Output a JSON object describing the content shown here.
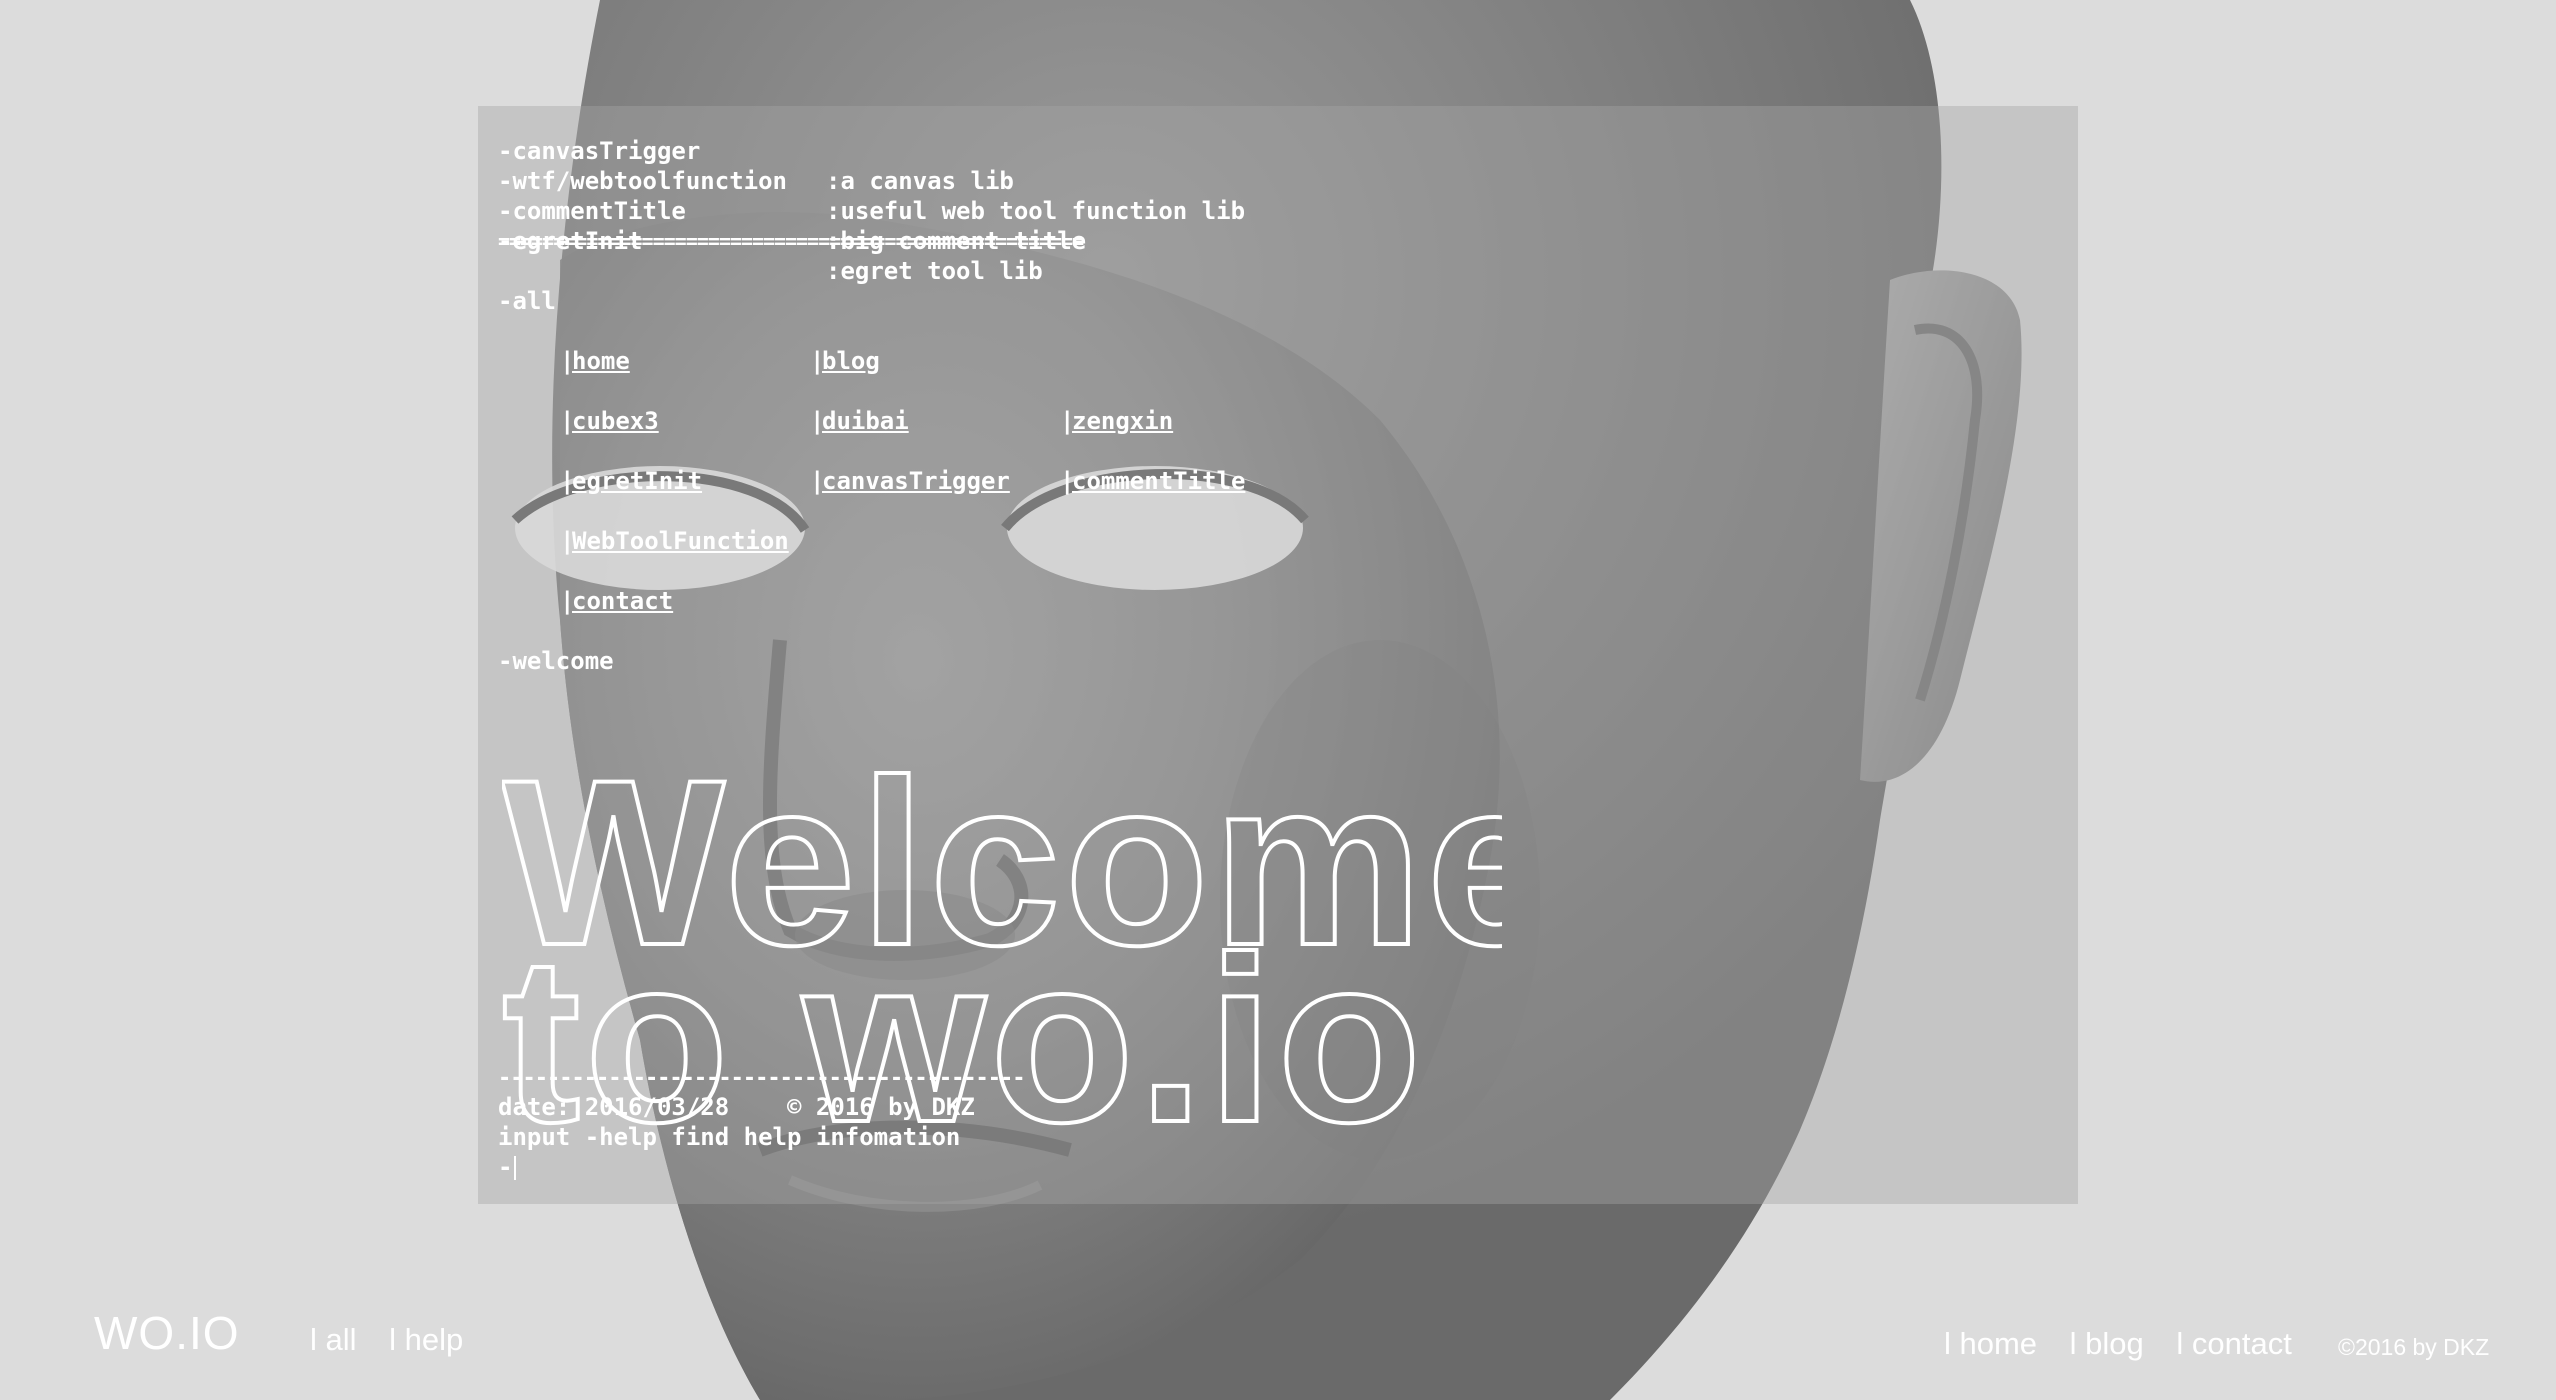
{
  "terminal": {
    "lib_lines": [
      {
        "cmd": "-canvasTrigger",
        "desc": ":a canvas lib"
      },
      {
        "cmd": "-wtf/webtoolfunction",
        "desc": ":useful web tool function lib"
      },
      {
        "cmd": "-commentTitle",
        "desc": ":big comment title"
      },
      {
        "cmd": "-egretInit",
        "desc": ":egret tool lib"
      }
    ],
    "double_rule": "=====================================================",
    "all_label": "-all",
    "links": {
      "home": "home",
      "blog": "blog",
      "cubex3": "cubex3",
      "duibai": "duibai",
      "zengxin": "zengxin",
      "egretInit": "egretInit",
      "canvasTrigger": "canvasTrigger",
      "commentTitle": "commentTitle",
      "webToolFunction": "WebToolFunction",
      "contact": "contact"
    },
    "pipe": "|",
    "welcome_label": "-welcome",
    "ascii_line1": "Welcome",
    "ascii_line2": "to wo.io",
    "single_rule": "-------------------------------------------",
    "date_line": "date: 2016/03/28    © 2016 by DKZ",
    "help_line": "input -help find help infomation",
    "prompt": "-"
  },
  "footer": {
    "brand": "WO.IO",
    "left_nav": [
      "l all",
      "l help"
    ],
    "right_nav": [
      "l home",
      "l blog",
      "l contact"
    ],
    "copyright": "©2016 by DKZ"
  }
}
